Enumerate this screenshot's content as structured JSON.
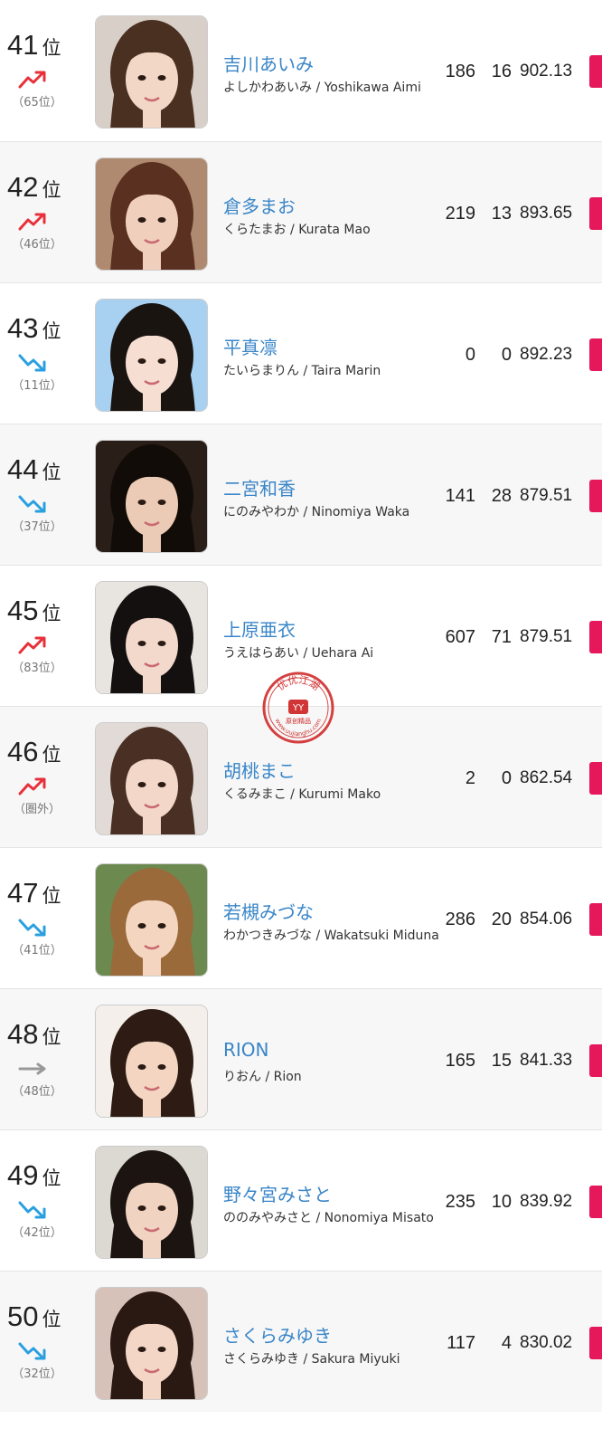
{
  "rank_unit": "位",
  "colors": {
    "up": "#e8303a",
    "down": "#2a9fe0",
    "same": "#999999",
    "name": "#3a86c8",
    "tag": "#e4185a",
    "seal": "#cc1f1f"
  },
  "watermark": {
    "text": "优优江湖",
    "sub": "原创精品",
    "url": "www.uujianghu.com"
  },
  "entries": [
    {
      "rank": "41",
      "trend": "up",
      "prev": "（65位）",
      "name_jp": "吉川あいみ",
      "name_sub": "よしかわあいみ / Yoshikawa Aimi",
      "a": "186",
      "b": "16",
      "score": "902.13",
      "photo": {
        "bg": "#d8cfc8",
        "hair": "#4a3020",
        "skin": "#f2d7c6"
      }
    },
    {
      "rank": "42",
      "trend": "up",
      "prev": "（46位）",
      "name_jp": "倉多まお",
      "name_sub": "くらたまお / Kurata Mao",
      "a": "219",
      "b": "13",
      "score": "893.65",
      "photo": {
        "bg": "#b08a70",
        "hair": "#5a3020",
        "skin": "#f0d0bc"
      }
    },
    {
      "rank": "43",
      "trend": "down",
      "prev": "（11位）",
      "name_jp": "平真凛",
      "name_sub": "たいらまりん / Taira Marin",
      "a": "0",
      "b": "0",
      "score": "892.23",
      "photo": {
        "bg": "#a8d0f0",
        "hair": "#1a1410",
        "skin": "#f6dfd2"
      }
    },
    {
      "rank": "44",
      "trend": "down",
      "prev": "（37位）",
      "name_jp": "二宮和香",
      "name_sub": "にのみやわか / Ninomiya Waka",
      "a": "141",
      "b": "28",
      "score": "879.51",
      "photo": {
        "bg": "#2a1e18",
        "hair": "#120c08",
        "skin": "#eccbb6"
      }
    },
    {
      "rank": "45",
      "trend": "up",
      "prev": "（83位）",
      "name_jp": "上原亜衣",
      "name_sub": "うえはらあい / Uehara Ai",
      "a": "607",
      "b": "71",
      "score": "879.51",
      "photo": {
        "bg": "#e8e4e0",
        "hair": "#141010",
        "skin": "#f3d9cb"
      }
    },
    {
      "rank": "46",
      "trend": "up",
      "prev": "（圏外）",
      "name_jp": "胡桃まこ",
      "name_sub": "くるみまこ / Kurumi Mako",
      "a": "2",
      "b": "0",
      "score": "862.54",
      "photo": {
        "bg": "#e2dad6",
        "hair": "#4a3024",
        "skin": "#f3d8c9"
      }
    },
    {
      "rank": "47",
      "trend": "down",
      "prev": "（41位）",
      "name_jp": "若槻みづな",
      "name_sub": "わかつきみづな / Wakatsuki Miduna",
      "a": "286",
      "b": "20",
      "score": "854.06",
      "photo": {
        "bg": "#6c8a50",
        "hair": "#9a6a3a",
        "skin": "#f4d6c0"
      }
    },
    {
      "rank": "48",
      "trend": "same",
      "prev": "（48位）",
      "name_jp": "RION",
      "name_sub": "りおん / Rion",
      "a": "165",
      "b": "15",
      "score": "841.33",
      "photo": {
        "bg": "#f4efea",
        "hair": "#2e1c14",
        "skin": "#f3d5c2"
      }
    },
    {
      "rank": "49",
      "trend": "down",
      "prev": "（42位）",
      "name_jp": "野々宮みさと",
      "name_sub": "ののみやみさと / Nonomiya Misato",
      "a": "235",
      "b": "10",
      "score": "839.92",
      "photo": {
        "bg": "#dcd8d2",
        "hair": "#1c1410",
        "skin": "#f1d3c2"
      }
    },
    {
      "rank": "50",
      "trend": "down",
      "prev": "（32位）",
      "name_jp": "さくらみゆき",
      "name_sub": "さくらみゆき / Sakura Miyuki",
      "a": "117",
      "b": "4",
      "score": "830.02",
      "photo": {
        "bg": "#d6c2b8",
        "hair": "#2a1812",
        "skin": "#f3d6c5"
      }
    }
  ]
}
